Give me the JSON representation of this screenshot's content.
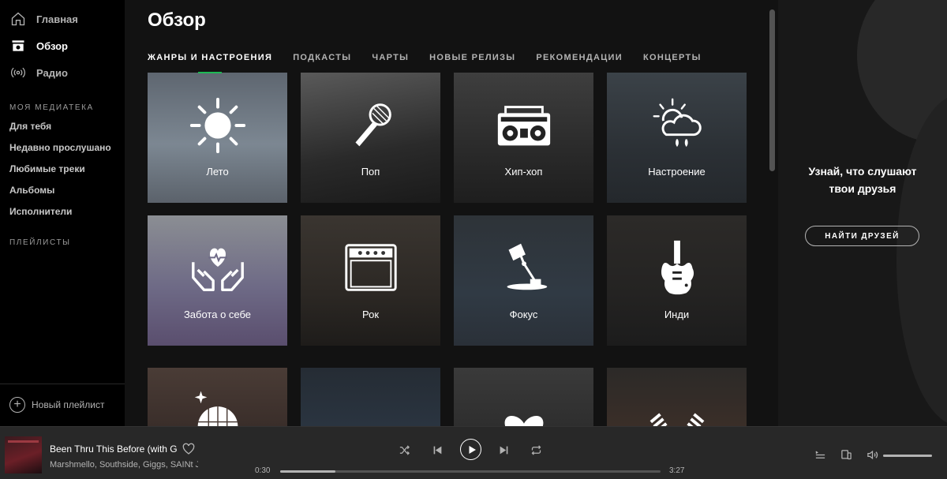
{
  "sidebar": {
    "nav": [
      {
        "label": "Главная",
        "icon": "home-icon"
      },
      {
        "label": "Обзор",
        "icon": "browse-icon"
      },
      {
        "label": "Радио",
        "icon": "radio-icon"
      }
    ],
    "library_label": "МОЯ МЕДИАТЕКА",
    "library": [
      "Для тебя",
      "Недавно прослушано",
      "Любимые треки",
      "Альбомы",
      "Исполнители"
    ],
    "playlists_label": "ПЛЕЙЛИСТЫ",
    "new_playlist": "Новый плейлист"
  },
  "main": {
    "title": "Обзор",
    "tabs": [
      "ЖАНРЫ И НАСТРОЕНИЯ",
      "ПОДКАСТЫ",
      "ЧАРТЫ",
      "НОВЫЕ РЕЛИЗЫ",
      "РЕКОМЕНДАЦИИ",
      "КОНЦЕРТЫ"
    ],
    "tiles": [
      {
        "label": "Лето",
        "icon": "sun-icon"
      },
      {
        "label": "Поп",
        "icon": "microphone-icon"
      },
      {
        "label": "Хип-хоп",
        "icon": "boombox-icon"
      },
      {
        "label": "Настроение",
        "icon": "weather-icon"
      },
      {
        "label": "Забота о себе",
        "icon": "hands-heart-icon"
      },
      {
        "label": "Рок",
        "icon": "amplifier-icon"
      },
      {
        "label": "Фокус",
        "icon": "desk-lamp-icon"
      },
      {
        "label": "Инди",
        "icon": "guitar-icon"
      },
      {
        "label": "",
        "icon": "disco-ball-icon"
      },
      {
        "label": "",
        "icon": "cassette-icon"
      },
      {
        "label": "",
        "icon": "heart-icon"
      },
      {
        "label": "",
        "icon": "korea-flag-icon"
      }
    ]
  },
  "friends": {
    "text_line1": "Узнай, что слушают",
    "text_line2": "твои друзья",
    "button": "НАЙТИ ДРУЗЕЙ"
  },
  "player": {
    "title": "Been Thru This Before (with Giggs)",
    "artists": "Marshmello, Southside, Giggs, SAINt JHN",
    "elapsed": "0:30",
    "duration": "3:27",
    "progress": 0.145,
    "volume": 1.0
  }
}
